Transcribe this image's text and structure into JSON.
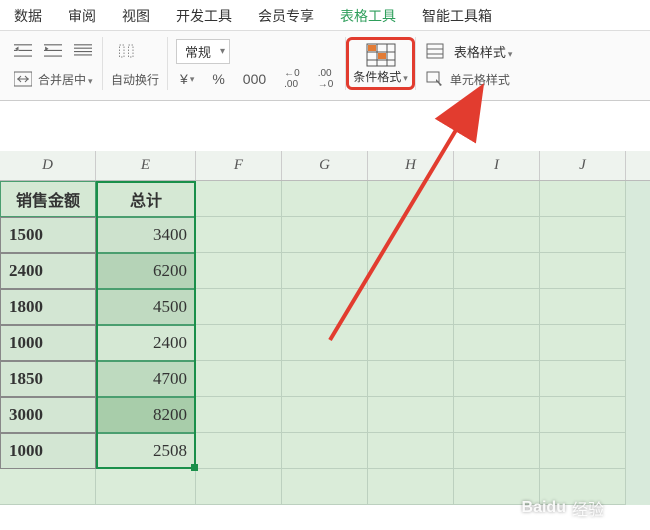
{
  "tabs": {
    "data": "数据",
    "review": "审阅",
    "view": "视图",
    "dev": "开发工具",
    "member": "会员专享",
    "tabletools": "表格工具",
    "smarttools": "智能工具箱"
  },
  "ribbon": {
    "merge_center": "合并居中",
    "auto_wrap": "自动换行",
    "number_format": "常规",
    "currency": "¥",
    "percent": "%",
    "thousands": "000",
    "inc_dec": "←0 .00",
    "dec_dec": ".00 →0",
    "cond_format": "条件格式",
    "table_style": "表格样式",
    "cell_style": "单元格样式"
  },
  "columns": [
    "D",
    "E",
    "F",
    "G",
    "H",
    "I",
    "J"
  ],
  "headers": {
    "d": "销售金额",
    "e": "总计"
  },
  "chart_data": {
    "type": "table",
    "columns": [
      "销售金额",
      "总计"
    ],
    "rows": [
      {
        "d": "1500",
        "e": "3400"
      },
      {
        "d": "2400",
        "e": "6200"
      },
      {
        "d": "1800",
        "e": "4500"
      },
      {
        "d": "1000",
        "e": "2400"
      },
      {
        "d": "1850",
        "e": "4700"
      },
      {
        "d": "3000",
        "e": "8200"
      },
      {
        "d": "1000",
        "e": "2508"
      }
    ]
  },
  "watermark": {
    "brand": "Baidu",
    "sub": "经验"
  }
}
